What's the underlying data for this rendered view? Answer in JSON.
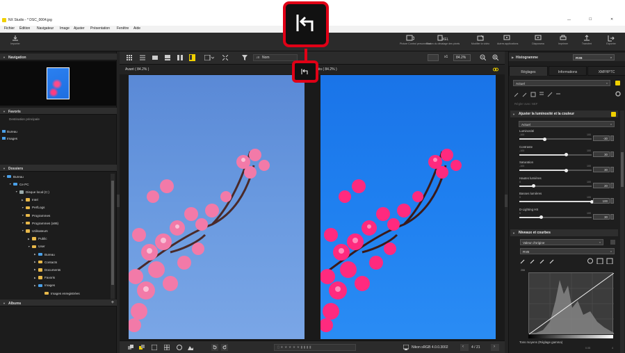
{
  "window": {
    "app_icon": "nx-studio-icon",
    "title": "NX Studio  - * DSC_0004.jpg",
    "controls": {
      "minimize": "—",
      "maximize": "☐",
      "close": "✕"
    }
  },
  "menu": [
    "Fichier",
    "Édition",
    "Navigateur",
    "Image",
    "Ajuster",
    "Présentation",
    "Fenêtre",
    "Aide"
  ],
  "toolbar": {
    "import": "Importer",
    "buttons": [
      "Picture Control personnalisé",
      "Fusion du décalage des pixels",
      "Modifier la vidéo",
      "Autres applications",
      "Diaporama",
      "Imprimer",
      "Transfert",
      "Exporter"
    ]
  },
  "left": {
    "navigation": "Navigation",
    "favoris": "Favoris",
    "destination": "Destination principale",
    "fav_items": [
      "Bureau",
      "Images"
    ],
    "dossiers": "Dossiers",
    "tree": [
      {
        "label": "Bureau",
        "level": 0,
        "icon": "blue"
      },
      {
        "label": "Ce PC",
        "level": 1,
        "icon": "pc"
      },
      {
        "label": "Disque local (C:)",
        "level": 2,
        "icon": "disk"
      },
      {
        "label": "Intel",
        "level": 3,
        "icon": "folder"
      },
      {
        "label": "PerfLogs",
        "level": 3,
        "icon": "folder"
      },
      {
        "label": "Programmes",
        "level": 3,
        "icon": "folder"
      },
      {
        "label": "Programmes (x86)",
        "level": 3,
        "icon": "folder"
      },
      {
        "label": "Utilisateurs",
        "level": 3,
        "icon": "folder"
      },
      {
        "label": "Public",
        "level": 4,
        "icon": "folder"
      },
      {
        "label": "User",
        "level": 4,
        "icon": "folder"
      },
      {
        "label": "Bureau",
        "level": 5,
        "icon": "blue"
      },
      {
        "label": "Contacts",
        "level": 5,
        "icon": "folder"
      },
      {
        "label": "Documents",
        "level": 5,
        "icon": "folder"
      },
      {
        "label": "Favoris",
        "level": 5,
        "icon": "folder"
      },
      {
        "label": "Images",
        "level": 5,
        "icon": "blue"
      },
      {
        "label": "Images enregistrées",
        "level": 6,
        "icon": "folder"
      }
    ],
    "albums": "Albums",
    "albums_add": "+"
  },
  "view": {
    "sort": "Nom",
    "zoom_x": "x1",
    "zoom": "84.2%",
    "before": "Avant ( 84.2% )",
    "after": "rès ( 84.2% )"
  },
  "bottom": {
    "profile": "Nikon sRGB 4.0.0.3002",
    "page": "4 / 21"
  },
  "right": {
    "histogram": "Histogramme",
    "hist_mode": "RVB",
    "tabs": [
      "Réglages",
      "Informations",
      "XMP/IPTC"
    ],
    "preset": "Actuel",
    "tool_note": "Régler avec NEF",
    "section1": "Ajuster la luminosité et la couleur",
    "section1_preset": "Actuel",
    "sliders": [
      {
        "name": "Luminosité",
        "min": "-100",
        "max": "100",
        "value": "-30",
        "frac": 0.35
      },
      {
        "name": "Contraste",
        "min": "-100",
        "max": "100",
        "value": "30",
        "frac": 0.65
      },
      {
        "name": "Saturation",
        "min": "-100",
        "max": "100",
        "value": "30",
        "frac": 0.65
      },
      {
        "name": "Hautes lumières",
        "min": "0",
        "max": "100",
        "value": "20",
        "frac": 0.2
      },
      {
        "name": "Basses lumières",
        "min": "0",
        "max": "100",
        "value": "100",
        "frac": 1.0
      },
      {
        "name": "D-Lighting HS",
        "min": "0",
        "max": "100",
        "value": "30",
        "frac": 0.3
      }
    ],
    "section2": "Niveaux et courbes",
    "levels_preset": "Valeur d'origine",
    "levels_channel": "RVB",
    "hist_top": "255",
    "gamma_label": "Tons moyens (Réglage gamma)",
    "gamma_min": "0.05",
    "gamma_max": "4"
  },
  "callout": {
    "icon": "compare-toggle-icon"
  },
  "colors": {
    "callout": "#e00016",
    "accent": "#f0d000"
  }
}
